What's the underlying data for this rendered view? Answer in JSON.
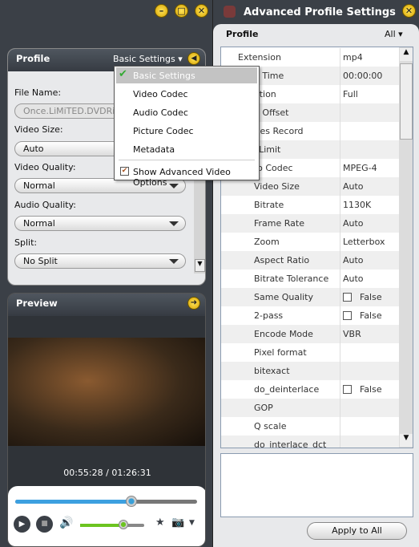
{
  "main_window": {
    "controls": [
      "minimize",
      "maximize",
      "close"
    ],
    "profile": {
      "title": "Profile",
      "settings_dropdown": "Basic Settings",
      "file_name_label": "File Name:",
      "file_name_value": "Once.LiMiTED.DVDRip.X",
      "video_size_label": "Video Size:",
      "video_size_value": "Auto",
      "video_quality_label": "Video Quality:",
      "video_quality_value": "Normal",
      "audio_quality_label": "Audio Quality:",
      "audio_quality_value": "Normal",
      "split_label": "Split:",
      "split_value": "No Split"
    },
    "menu": {
      "items": [
        "Basic Settings",
        "Video Codec",
        "Audio Codec",
        "Picture Codec",
        "Metadata"
      ],
      "selected": "Basic Settings",
      "checkbox_label": "Show Advanced Video Options",
      "checkbox_checked": true
    },
    "preview": {
      "title": "Preview",
      "time": "00:55:28 / 01:26:31",
      "seek_progress": 0.64,
      "volume": 0.68
    }
  },
  "advanced": {
    "title": "Advanced Profile Settings",
    "profile_label": "Profile",
    "filter": "All",
    "rows": [
      {
        "key": "Extension",
        "value": "mp4",
        "level": 1
      },
      {
        "key": "Start Time",
        "value": "00:00:00",
        "level": 1
      },
      {
        "key": "Duration",
        "value": "Full",
        "level": 1
      },
      {
        "key": "Time Offset",
        "value": "",
        "level": 1
      },
      {
        "key": "Frames Record",
        "value": "",
        "level": 1
      },
      {
        "key": "Size Limit",
        "value": "",
        "level": 1
      },
      {
        "key": "Video Codec",
        "value": "MPEG-4",
        "level": 1
      },
      {
        "key": "Video Size",
        "value": "Auto",
        "level": 2
      },
      {
        "key": "Bitrate",
        "value": "1130K",
        "level": 2
      },
      {
        "key": "Frame Rate",
        "value": "Auto",
        "level": 2
      },
      {
        "key": "Zoom",
        "value": "Letterbox",
        "level": 2
      },
      {
        "key": "Aspect Ratio",
        "value": "Auto",
        "level": 2
      },
      {
        "key": "Bitrate Tolerance",
        "value": "Auto",
        "level": 2
      },
      {
        "key": "Same Quality",
        "value": "False",
        "level": 2,
        "checkbox": true
      },
      {
        "key": "2-pass",
        "value": "False",
        "level": 2,
        "checkbox": true
      },
      {
        "key": "Encode Mode",
        "value": "VBR",
        "level": 2
      },
      {
        "key": "Pixel format",
        "value": "",
        "level": 2
      },
      {
        "key": "bitexact",
        "value": "",
        "level": 2
      },
      {
        "key": "do_deinterlace",
        "value": "False",
        "level": 2,
        "checkbox": true
      },
      {
        "key": "GOP",
        "value": "",
        "level": 2
      },
      {
        "key": "Q scale",
        "value": "",
        "level": 2
      },
      {
        "key": "do_interlace_dct",
        "value": "",
        "level": 2
      }
    ],
    "apply_button": "Apply to All"
  }
}
